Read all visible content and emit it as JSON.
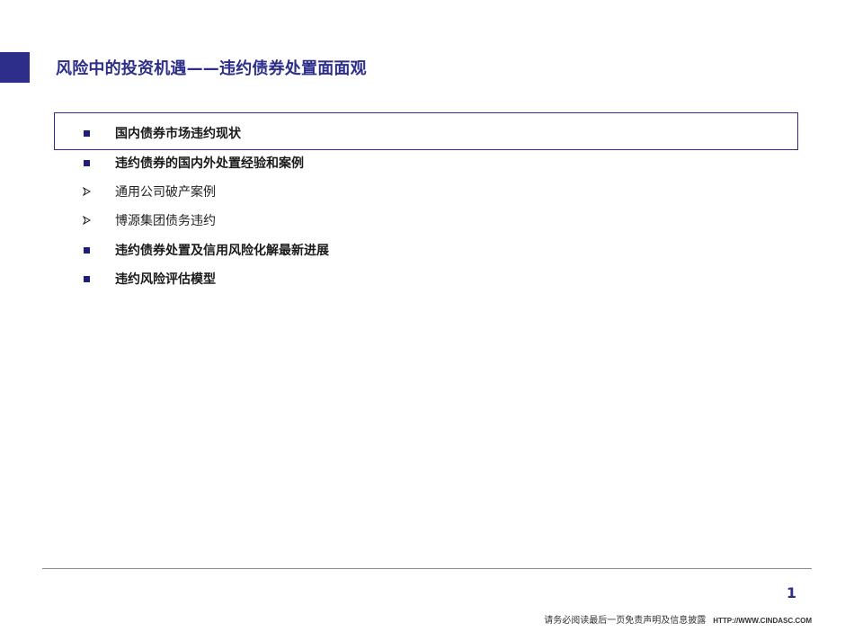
{
  "slide": {
    "title": "风险中的投资机遇——违约债券处置面面观",
    "page_number": "1"
  },
  "agenda": {
    "items": [
      {
        "label": "国内债券市场违约现状",
        "bullet": "square-icon",
        "level": 1,
        "highlighted": true
      },
      {
        "label": "违约债券的国内外处置经验和案例",
        "bullet": "square-icon",
        "level": 1
      },
      {
        "label": "通用公司破产案例",
        "bullet": "arrow-icon",
        "level": 2
      },
      {
        "label": "博源集团债务违约",
        "bullet": "arrow-icon",
        "level": 2
      },
      {
        "label": "违约债券处置及信用风险化解最新进展",
        "bullet": "square-icon",
        "level": 1
      },
      {
        "label": "违约风险评估模型",
        "bullet": "square-icon",
        "level": 1
      }
    ]
  },
  "footer": {
    "disclaimer": "请务必阅读最后一页免责声明及信息披露",
    "url": "HTTP://WWW.CINDASC.COM"
  },
  "colors": {
    "accent": "#2d2d8a",
    "text": "#1a1a1a",
    "divider": "#8c8c8c"
  }
}
